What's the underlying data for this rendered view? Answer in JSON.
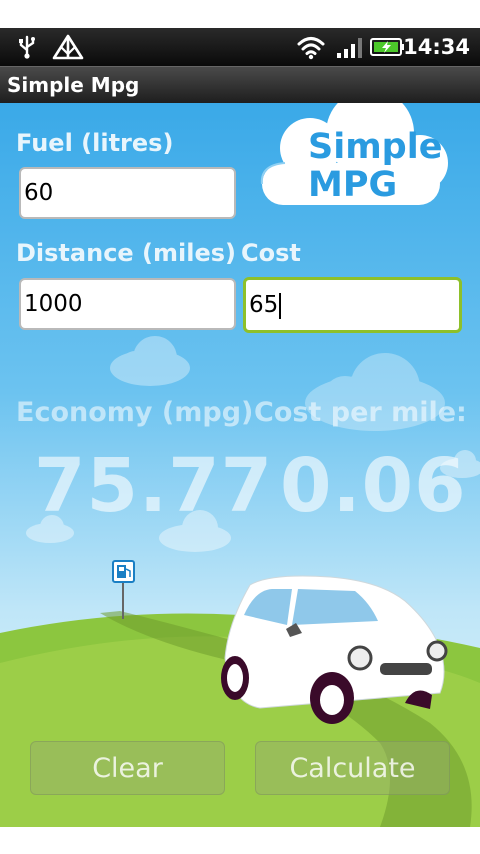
{
  "status_bar": {
    "time": "14:34",
    "icons": [
      "usb-icon",
      "signal-warning-icon",
      "wifi-icon",
      "cell-signal-icon",
      "battery-charging-icon"
    ]
  },
  "title_bar": {
    "title": "Simple Mpg"
  },
  "logo": {
    "line1": "Simple",
    "line2": "MPG"
  },
  "form": {
    "fuel_label": "Fuel (litres)",
    "fuel_value": "60",
    "distance_label": "Distance (miles)",
    "distance_value": "1000",
    "cost_label": "Cost",
    "cost_value": "65"
  },
  "results": {
    "economy_label": "Economy (mpg)",
    "economy_value": "75.77",
    "cost_per_mile_label": "Cost per mile:",
    "cost_per_mile_value": "0.06"
  },
  "buttons": {
    "clear": "Clear",
    "calculate": "Calculate"
  },
  "colors": {
    "sky_top": "#3aa9e8",
    "grass": "#8cc63f",
    "focus_border": "#8ec02a",
    "logo_text": "#2a9be0"
  }
}
